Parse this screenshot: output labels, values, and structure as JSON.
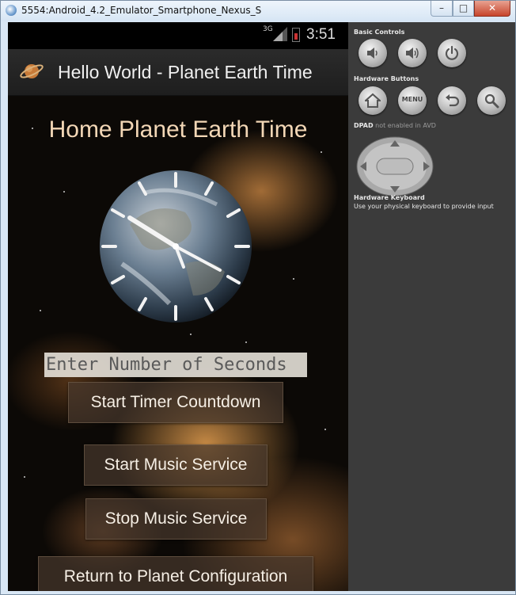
{
  "window": {
    "title": "5554:Android_4.2_Emulator_Smartphone_Nexus_S"
  },
  "status_bar": {
    "network": "3G",
    "time": "3:51"
  },
  "action_bar": {
    "title": "Hello World - Planet Earth Time"
  },
  "main": {
    "heading": "Home Planet Earth Time",
    "seconds_input_placeholder": "Enter Number of Seconds",
    "buttons": {
      "start_timer": "Start Timer Countdown",
      "start_music": "Start Music Service",
      "stop_music": "Stop Music Service",
      "return_config": "Return to Planet Configuration"
    }
  },
  "emulator": {
    "basic_controls_label": "Basic Controls",
    "hardware_buttons_label": "Hardware Buttons",
    "menu_button_label": "MENU",
    "dpad_label": "DPAD",
    "dpad_note": "not enabled in AVD",
    "keyboard_label": "Hardware Keyboard",
    "keyboard_hint": "Use your physical keyboard to provide input"
  },
  "colors": {
    "accent_text": "#f3d7b6",
    "emulator_panel": "#3b3b3b",
    "button_bg": "#46372d"
  }
}
